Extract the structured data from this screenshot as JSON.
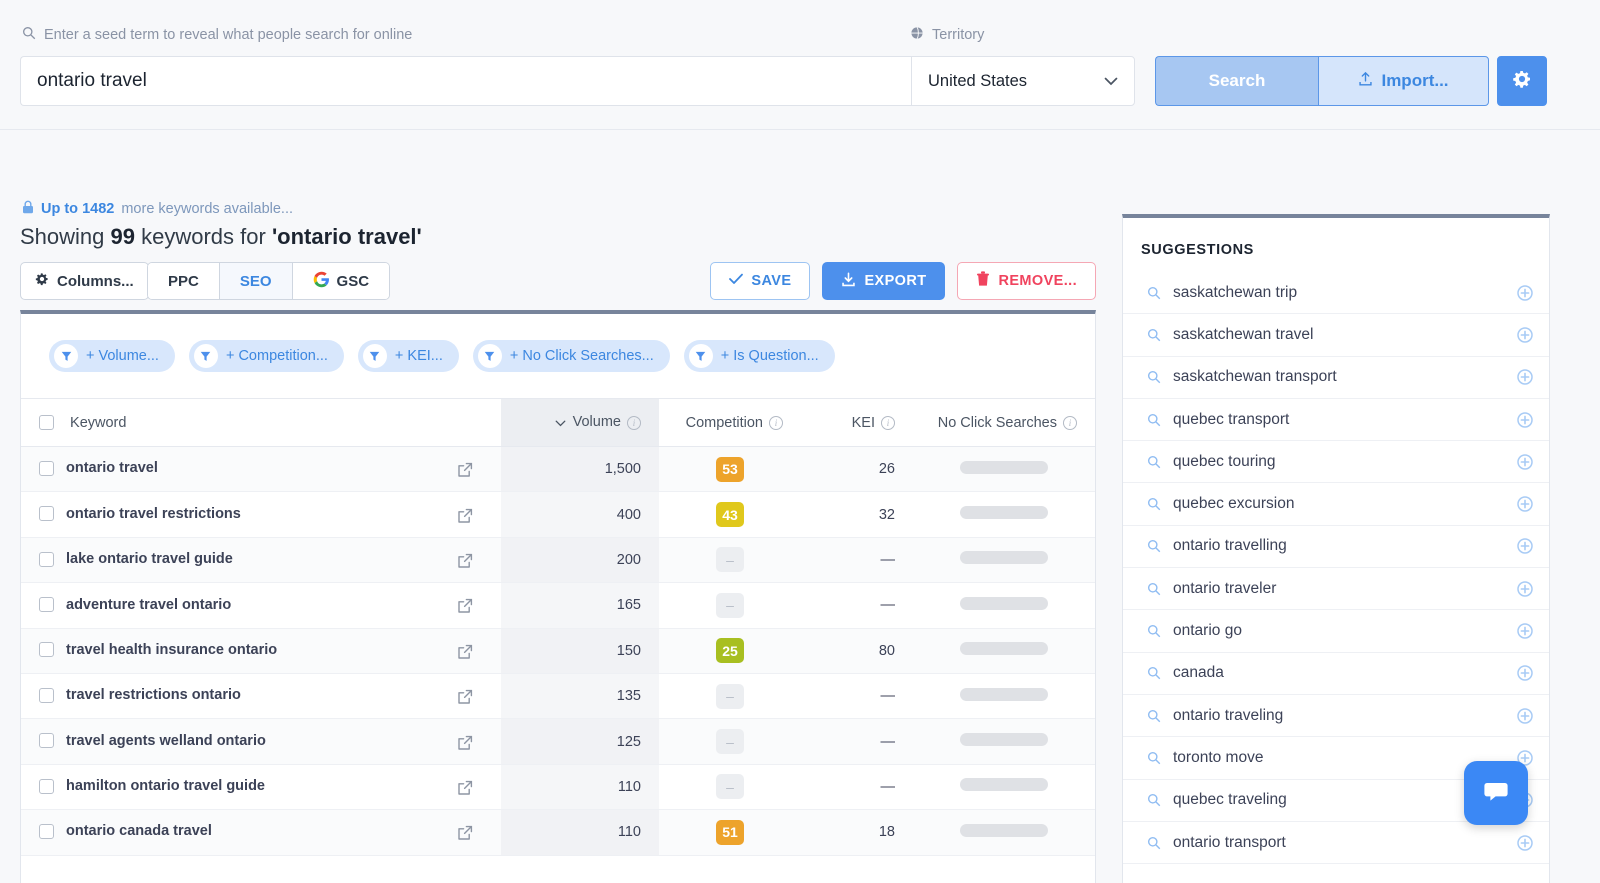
{
  "search": {
    "seed_label": "Enter a seed term to reveal what people search for online",
    "seed_value": "ontario travel",
    "territory_label": "Territory",
    "territory_value": "United States",
    "search_button": "Search",
    "import_button": "Import...",
    "settings_icon": "gear-icon"
  },
  "results": {
    "upsell_strong": "Up to 1482",
    "upsell_rest": "more keywords available...",
    "showing_prefix": "Showing ",
    "showing_count": "99",
    "showing_mid": " keywords for ",
    "showing_term": "'ontario travel'",
    "columns_button": "Columns...",
    "segments": [
      {
        "label": "PPC",
        "active": false
      },
      {
        "label": "SEO",
        "active": true
      },
      {
        "label": "GSC",
        "active": false,
        "icon": "google-icon"
      }
    ],
    "save_button": "SAVE",
    "export_button": "EXPORT",
    "remove_button": "REMOVE..."
  },
  "filters": [
    {
      "label": "+ Volume..."
    },
    {
      "label": "+ Competition..."
    },
    {
      "label": "+ KEI..."
    },
    {
      "label": "+ No Click Searches..."
    },
    {
      "label": "+ Is Question..."
    }
  ],
  "table": {
    "headers": {
      "keyword": "Keyword",
      "volume": "Volume",
      "competition": "Competition",
      "kei": "KEI",
      "no_click": "No Click Searches"
    },
    "sort_column": "Volume",
    "sort_direction": "desc",
    "rows": [
      {
        "keyword": "ontario travel",
        "volume": "1,500",
        "competition": "53",
        "comp_color": "#eda32b",
        "kei": "26"
      },
      {
        "keyword": "ontario travel restrictions",
        "volume": "400",
        "competition": "43",
        "comp_color": "#e0c81c",
        "kei": "32"
      },
      {
        "keyword": "lake ontario travel guide",
        "volume": "200",
        "competition": "–",
        "comp_color": "",
        "kei": "—"
      },
      {
        "keyword": "adventure travel ontario",
        "volume": "165",
        "competition": "–",
        "comp_color": "",
        "kei": "—"
      },
      {
        "keyword": "travel health insurance ontario",
        "volume": "150",
        "competition": "25",
        "comp_color": "#a8bf21",
        "kei": "80"
      },
      {
        "keyword": "travel restrictions ontario",
        "volume": "135",
        "competition": "–",
        "comp_color": "",
        "kei": "—"
      },
      {
        "keyword": "travel agents welland ontario",
        "volume": "125",
        "competition": "–",
        "comp_color": "",
        "kei": "—"
      },
      {
        "keyword": "hamilton ontario travel guide",
        "volume": "110",
        "competition": "–",
        "comp_color": "",
        "kei": "—"
      },
      {
        "keyword": "ontario canada travel",
        "volume": "110",
        "competition": "51",
        "comp_color": "#eda32b",
        "kei": "18"
      }
    ]
  },
  "suggestions": {
    "title": "SUGGESTIONS",
    "items": [
      {
        "label": "saskatchewan trip"
      },
      {
        "label": "saskatchewan travel"
      },
      {
        "label": "saskatchewan transport"
      },
      {
        "label": "quebec transport"
      },
      {
        "label": "quebec touring"
      },
      {
        "label": "quebec excursion"
      },
      {
        "label": "ontario travelling"
      },
      {
        "label": "ontario traveler"
      },
      {
        "label": "ontario go"
      },
      {
        "label": "canada"
      },
      {
        "label": "ontario traveling"
      },
      {
        "label": "toronto move"
      },
      {
        "label": "quebec traveling"
      },
      {
        "label": "ontario transport"
      }
    ]
  },
  "chat": {
    "icon": "chat-bubble-icon"
  },
  "colors": {
    "accent_blue": "#4d90ec",
    "danger_red": "#f0435e",
    "panel_top_border": "#77849b"
  }
}
